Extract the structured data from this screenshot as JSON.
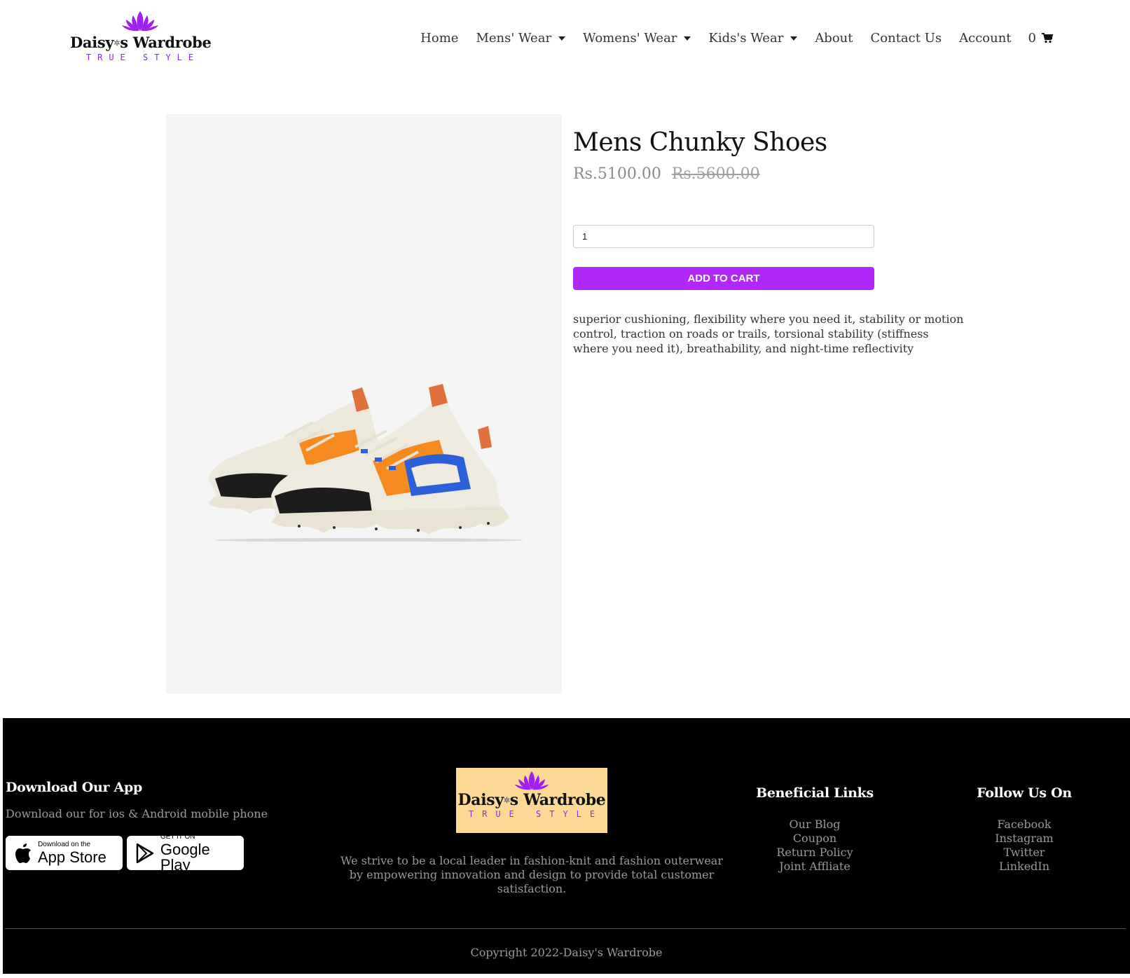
{
  "header": {
    "brand": {
      "name_part1": "Daisy",
      "name_part2": "s Wardrobe",
      "tagline": "TRUE STYLE",
      "accent_color": "#a020f0"
    },
    "nav": [
      {
        "label": "Home",
        "dropdown": false
      },
      {
        "label": "Mens' Wear",
        "dropdown": true
      },
      {
        "label": "Womens' Wear",
        "dropdown": true
      },
      {
        "label": "Kids's Wear",
        "dropdown": true
      },
      {
        "label": "About",
        "dropdown": false
      },
      {
        "label": "Contact Us",
        "dropdown": false
      },
      {
        "label": "Account",
        "dropdown": false
      }
    ],
    "cart_count": "0",
    "cart_icon": "cart-icon"
  },
  "product": {
    "title": "Mens Chunky Shoes",
    "price": "Rs.5100.00",
    "original_price": "Rs.5600.00",
    "quantity": "1",
    "add_to_cart_label": "ADD TO CART",
    "button_color": "#b128f8",
    "description": "superior cushioning, flexibility where you need it, stability or motion control, traction on roads or trails, torsional stability (stiffness where you need it), breathability, and night-time reflectivity",
    "image_icon": "sneaker-image"
  },
  "footer": {
    "app_heading": "Download Our App",
    "app_description": "Download our for ios & Android mobile phone",
    "app_store": {
      "small": "Download on the",
      "big": "App Store"
    },
    "google_play": {
      "small": "GET IT ON",
      "big": "Google Play"
    },
    "logo": {
      "name_part1": "Daisy",
      "name_part2": "s Wardrobe",
      "tagline": "TRUE STYLE",
      "background": "#fcd994"
    },
    "mission": "We strive to be a local leader in fashion-knit and fashion outerwear by empowering innovation and design to provide total customer satisfaction.",
    "beneficial_heading": "Beneficial Links",
    "beneficial_links": [
      "Our Blog",
      "Coupon",
      "Return Policy",
      "Joint Affliate"
    ],
    "follow_heading": "Follow Us On",
    "follow_links": [
      "Facebook",
      "Instagram",
      "Twitter",
      "LinkedIn"
    ],
    "copyright": "Copyright 2022-Daisy's Wardrobe"
  }
}
